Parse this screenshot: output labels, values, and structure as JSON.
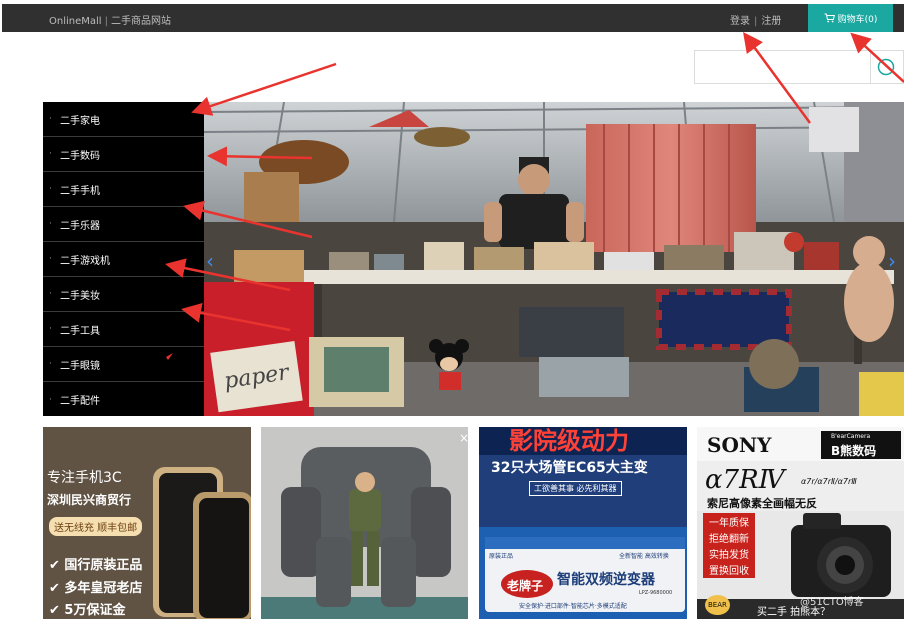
{
  "header": {
    "brand_name": "OnlineMall",
    "brand_sep": "|",
    "brand_tagline": "二手商品网站",
    "login": "登录",
    "link_sep": "|",
    "register": "注册",
    "cart_label": "购物车(0)",
    "cart_icon": "cart-icon",
    "bar_color": "#303030",
    "cart_color": "#1aa8a0"
  },
  "search": {
    "placeholder": "",
    "icon": "search-icon"
  },
  "categories": [
    {
      "label": "二手家电"
    },
    {
      "label": "二手数码"
    },
    {
      "label": "二手手机"
    },
    {
      "label": "二手乐器"
    },
    {
      "label": "二手游戏机"
    },
    {
      "label": "二手美妆"
    },
    {
      "label": "二手工具"
    },
    {
      "label": "二手眼镜"
    },
    {
      "label": "二手配件"
    }
  ],
  "banner": {
    "sign_text": "paper",
    "prev_icon": "chevron-left-icon",
    "next_icon": "chevron-right-icon"
  },
  "ads": [
    {
      "lines": [
        "专注手机3C",
        "深圳民兴商贸行",
        "送无线充 顺丰包邮",
        "✔ 国行原装正品",
        "✔ 多年皇冠老店",
        "✔ 5万保证金"
      ]
    },
    {
      "close": "×"
    },
    {
      "lines": [
        "影院级动力",
        "32只大场管EC65大主变",
        "工欲善其事 必先利其器",
        "原装正品",
        "全新智能 高效转换",
        "老牌子",
        "智能双频逆变器",
        "LPZ-9680000",
        "安全保护·进口部件·智能芯片·多模式适配"
      ]
    },
    {
      "lines": [
        "SONY",
        "B'earCamera",
        "B熊数码",
        "α7RⅣ",
        "α7r/α7rⅡ/α7rⅢ",
        "索尼高像素全画幅无反",
        "一年质保",
        "拒绝翻新",
        "实拍发货",
        "置换回收",
        "买二手 拍熊本？",
        "BEAR"
      ]
    }
  ],
  "watermark": "@51CTO博客"
}
